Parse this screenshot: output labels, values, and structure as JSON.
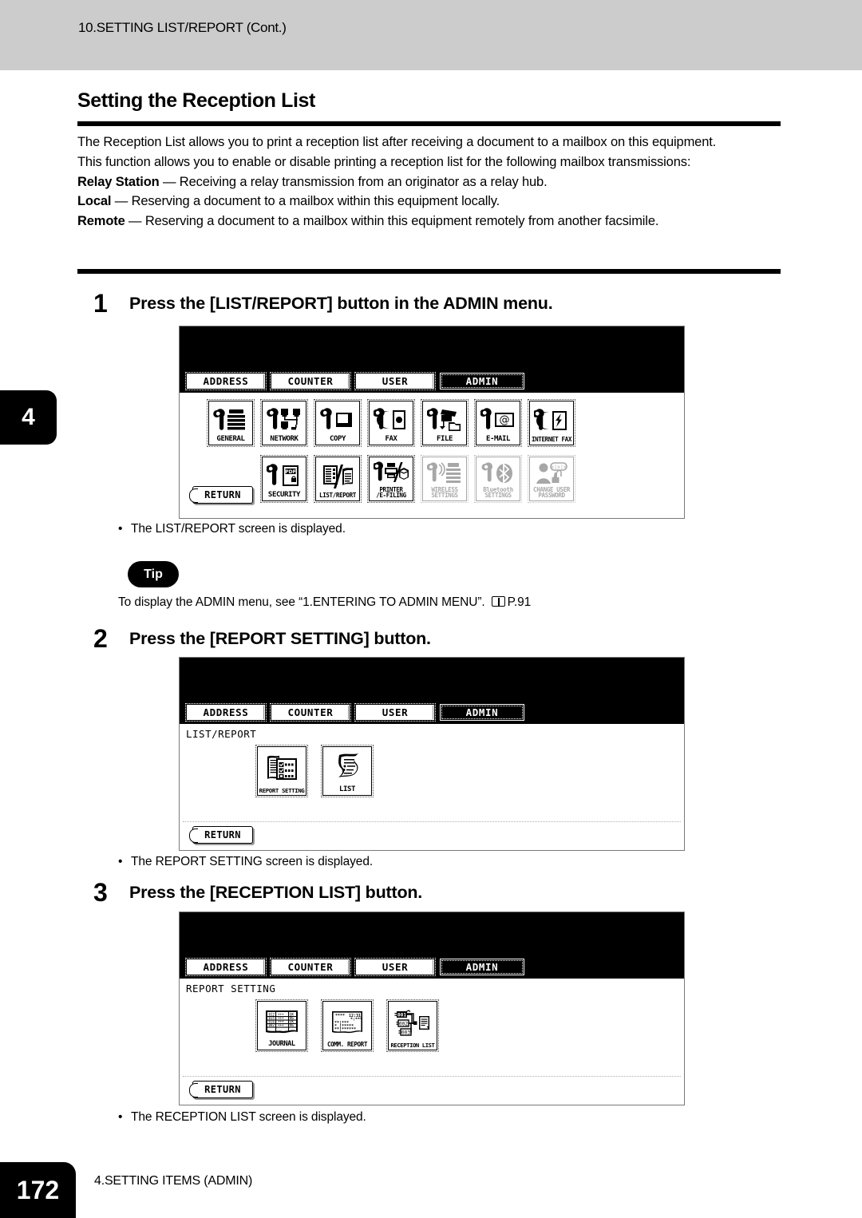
{
  "header": {
    "running_head": "10.SETTING LIST/REPORT (Cont.)"
  },
  "chapter_tab": {
    "number": "4"
  },
  "section": {
    "title": "Setting the Reception List",
    "paragraph_1": "The Reception List allows you to print a reception list after receiving a document to a mailbox on this equipment.",
    "paragraph_2": "This function allows you to enable or disable printing a reception list for the following mailbox transmissions:",
    "terms": [
      {
        "term": "Relay Station",
        "dash": " — ",
        "definition": "Receiving a relay transmission from an originator as a relay hub."
      },
      {
        "term": "Local",
        "dash": " — ",
        "definition": "Reserving a document to a mailbox within this equipment locally."
      },
      {
        "term": "Remote",
        "dash": " — ",
        "definition": "Reserving a document to a mailbox within this equipment remotely from another facsimile."
      }
    ]
  },
  "steps": [
    {
      "number": "1",
      "text": "Press the [LIST/REPORT] button in the ADMIN menu.",
      "note": "The LIST/REPORT screen is displayed."
    },
    {
      "number": "2",
      "text": "Press the [REPORT SETTING] button.",
      "note": "The REPORT SETTING screen is displayed."
    },
    {
      "number": "3",
      "text": "Press the [RECEPTION LIST] button.",
      "note": "The RECEPTION LIST screen is displayed."
    }
  ],
  "tip": {
    "label": "Tip",
    "body_before": "To display the ADMIN menu, see “1.ENTERING TO ADMIN MENU”.",
    "page_ref": "P.91"
  },
  "screens": [
    {
      "name": "admin-menu",
      "tabs": [
        {
          "label": "ADDRESS",
          "active": false
        },
        {
          "label": "COUNTER",
          "active": false
        },
        {
          "label": "USER",
          "active": false
        },
        {
          "label": "ADMIN",
          "active": true
        }
      ],
      "breadcrumb": "",
      "return_label": "RETURN",
      "buttons_row1": [
        {
          "label": "GENERAL",
          "icon": "wrench-copier-icon",
          "dim": false
        },
        {
          "label": "NETWORK",
          "icon": "wrench-network-icon",
          "dim": false
        },
        {
          "label": "COPY",
          "icon": "wrench-page-icon",
          "dim": false
        },
        {
          "label": "FAX",
          "icon": "wrench-handset-icon",
          "dim": false
        },
        {
          "label": "FILE",
          "icon": "wrench-file-folder-icon",
          "dim": false
        },
        {
          "label": "E-MAIL",
          "icon": "wrench-at-envelope-icon",
          "dim": false
        },
        {
          "label": "INTERNET FAX",
          "icon": "wrench-handset-bolt-icon",
          "dim": false
        }
      ],
      "buttons_row2": [
        {
          "label": "SECURITY",
          "icon": "wrench-pdf-lock-icon",
          "dim": false
        },
        {
          "label": "LIST/REPORT",
          "icon": "list-report-icon",
          "dim": false
        },
        {
          "label": "PRINTER /E-FILING",
          "label_line1": "PRINTER",
          "label_line2": "/E-FILING",
          "icon": "wrench-printer-box-icon",
          "dim": false
        },
        {
          "label": "WIRELESS SETTINGS",
          "label_line1": "WIRELESS",
          "label_line2": "SETTINGS",
          "icon": "wrench-wireless-icon",
          "dim": true
        },
        {
          "label": "Bluetooth SETTINGS",
          "label_line1": "Bluetooth",
          "label_line2": "SETTINGS",
          "icon": "wrench-bluetooth-icon",
          "dim": true
        },
        {
          "label": "CHANGE USER PASSWORD",
          "label_line1": "CHANGE USER",
          "label_line2": "PASSWORD",
          "icon": "user-password-icon",
          "dim": true
        }
      ]
    },
    {
      "name": "list-report",
      "tabs": [
        {
          "label": "ADDRESS",
          "active": false
        },
        {
          "label": "COUNTER",
          "active": false
        },
        {
          "label": "USER",
          "active": false
        },
        {
          "label": "ADMIN",
          "active": true
        }
      ],
      "breadcrumb": "LIST/REPORT",
      "return_label": "RETURN",
      "buttons": [
        {
          "label": "REPORT SETTING",
          "icon": "report-setting-icon"
        },
        {
          "label": "LIST",
          "icon": "list-sheet-icon"
        }
      ]
    },
    {
      "name": "report-setting",
      "tabs": [
        {
          "label": "ADDRESS",
          "active": false
        },
        {
          "label": "COUNTER",
          "active": false
        },
        {
          "label": "USER",
          "active": false
        },
        {
          "label": "ADMIN",
          "active": true
        }
      ],
      "breadcrumb": "REPORT SETTING",
      "return_label": "RETURN",
      "buttons": [
        {
          "label": "JOURNAL",
          "icon": "journal-table-icon"
        },
        {
          "label": "COMM. REPORT",
          "icon": "comm-report-icon"
        },
        {
          "label": "RECEPTION LIST",
          "icon": "reception-list-icon"
        }
      ]
    }
  ],
  "footer": {
    "page_number": "172",
    "chapter_title": "4.SETTING ITEMS (ADMIN)"
  }
}
